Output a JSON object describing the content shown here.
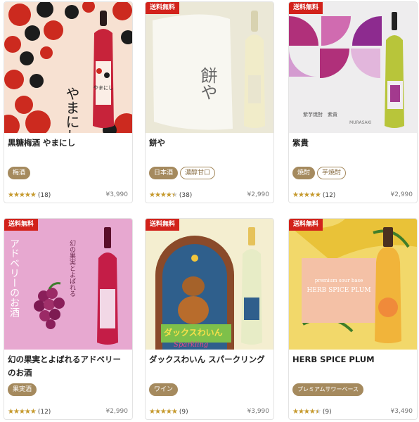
{
  "shipping_badge": "送料無料",
  "products": [
    {
      "name": "黒糖梅酒 やまにし",
      "tags": [
        "梅酒"
      ],
      "rating": 5.0,
      "review_count": "(18)",
      "price": "¥3,990",
      "shipping": false,
      "art": {
        "label": "やまにし",
        "bottle_label": "やまにし"
      }
    },
    {
      "name": "餅や",
      "tags": [
        "日本酒",
        "濃醇甘口"
      ],
      "rating": 4.5,
      "review_count": "(38)",
      "price": "¥2,990",
      "shipping": true,
      "art": {
        "label": "餅や"
      }
    },
    {
      "name": "紫貴",
      "tags": [
        "焼酎",
        "芋焼酎"
      ],
      "rating": 5.0,
      "review_count": "(12)",
      "price": "¥2,990",
      "shipping": true,
      "art": {
        "label": "紫芋焼酎　紫貴",
        "sublabel": "MURASAKI"
      }
    },
    {
      "name": "幻の果実とよばれるアドベリーのお酒",
      "tags": [
        "果実酒"
      ],
      "rating": 5.0,
      "review_count": "(12)",
      "price": "¥2,990",
      "shipping": true,
      "art": {
        "label": "アドベリーのお酒",
        "sublabel": "幻の果実とよばれる"
      }
    },
    {
      "name": "ダックスわいん スパークリング",
      "tags": [
        "ワイン"
      ],
      "rating": 5.0,
      "review_count": "(9)",
      "price": "¥3,990",
      "shipping": true,
      "art": {
        "label": "ダックスわいん",
        "sublabel": "Sparkling"
      }
    },
    {
      "name": "HERB SPICE PLUM",
      "tags": [
        "プレミアムサワーベース"
      ],
      "rating": 4.5,
      "review_count": "(9)",
      "price": "¥3,490",
      "shipping": true,
      "art": {
        "label": "HERB SPICE PLUM",
        "sublabel": "premium sour base"
      }
    }
  ],
  "colors": {
    "badge": "#d2221b",
    "tag": "#a58a5e",
    "star": "#c79a2c"
  }
}
